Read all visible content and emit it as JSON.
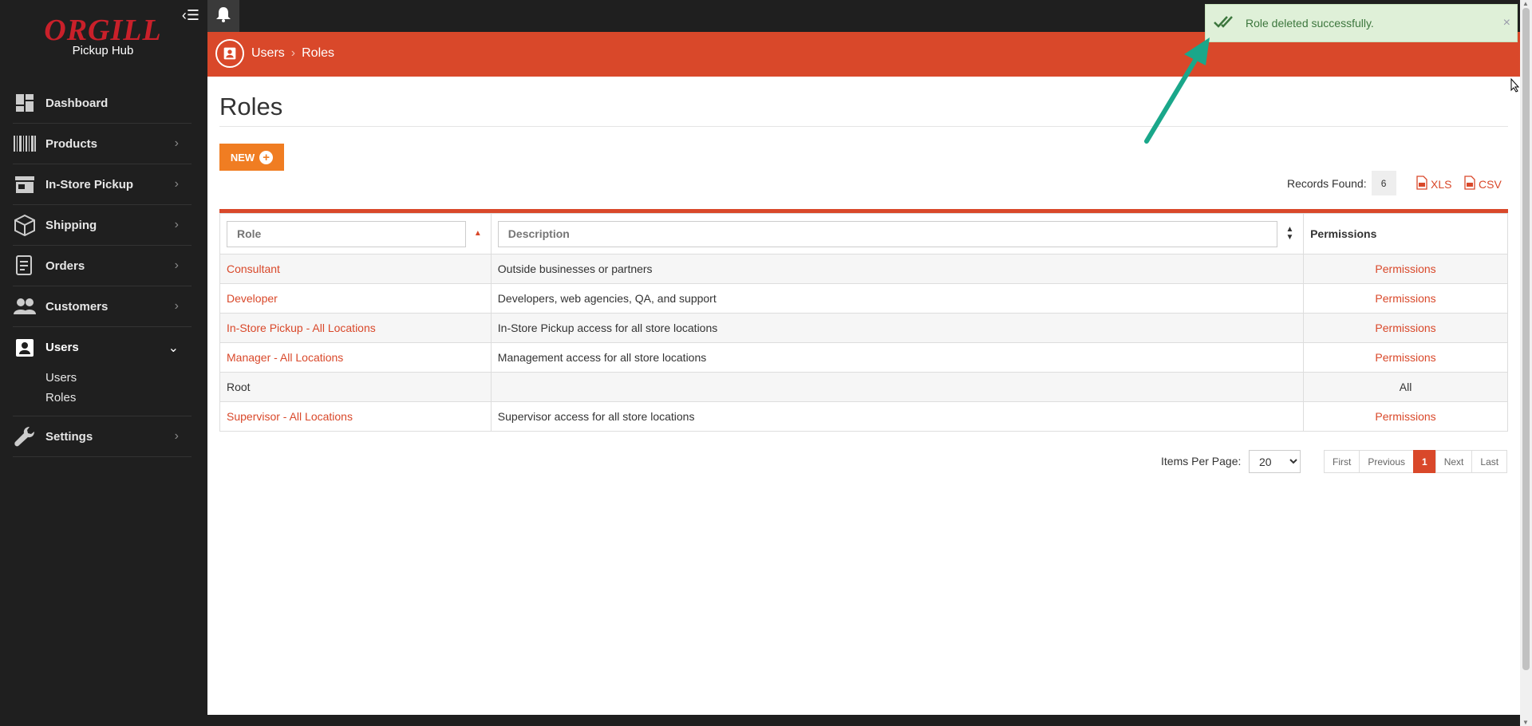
{
  "brand": {
    "name": "ORGILL",
    "sub": "Pickup Hub"
  },
  "sidebar": {
    "items": [
      {
        "label": "Dashboard",
        "icon": "dashboard-icon"
      },
      {
        "label": "Products",
        "icon": "barcode-icon"
      },
      {
        "label": "In-Store Pickup",
        "icon": "store-icon"
      },
      {
        "label": "Shipping",
        "icon": "box-icon"
      },
      {
        "label": "Orders",
        "icon": "orders-icon"
      },
      {
        "label": "Customers",
        "icon": "customers-icon"
      },
      {
        "label": "Users",
        "icon": "user-badge-icon"
      },
      {
        "label": "Settings",
        "icon": "wrench-icon"
      }
    ],
    "users_sub": [
      "Users",
      "Roles"
    ]
  },
  "breadcrumb": {
    "parent": "Users",
    "current": "Roles"
  },
  "page": {
    "title": "Roles",
    "new_label": "NEW"
  },
  "records": {
    "label": "Records Found:",
    "count": "6"
  },
  "exports": {
    "xls": "XLS",
    "csv": "CSV"
  },
  "table": {
    "role_placeholder": "Role",
    "description_placeholder": "Description",
    "permissions_header": "Permissions",
    "rows": [
      {
        "role": "Consultant",
        "description": "Outside businesses or partners",
        "permissions": "Permissions"
      },
      {
        "role": "Developer",
        "description": "Developers, web agencies, QA, and support",
        "permissions": "Permissions"
      },
      {
        "role": "In-Store Pickup - All Locations",
        "description": "In-Store Pickup access for all store locations",
        "permissions": "Permissions"
      },
      {
        "role": "Manager - All Locations",
        "description": "Management access for all store locations",
        "permissions": "Permissions"
      },
      {
        "role": "Root",
        "description": "",
        "permissions": "All"
      },
      {
        "role": "Supervisor - All Locations",
        "description": "Supervisor access for all store locations",
        "permissions": "Permissions"
      }
    ]
  },
  "pagination": {
    "items_per_page_label": "Items Per Page:",
    "items_per_page": "20",
    "first": "First",
    "previous": "Previous",
    "current": "1",
    "next": "Next",
    "last": "Last"
  },
  "toast": {
    "message": "Role deleted successfully.",
    "close": "×"
  },
  "colors": {
    "accent": "#d9482a",
    "button": "#f07d22",
    "brand": "#c9202a",
    "sidebar": "#1f1f1f",
    "toast_bg": "#dff0d8",
    "arrow": "#1aa78a"
  }
}
